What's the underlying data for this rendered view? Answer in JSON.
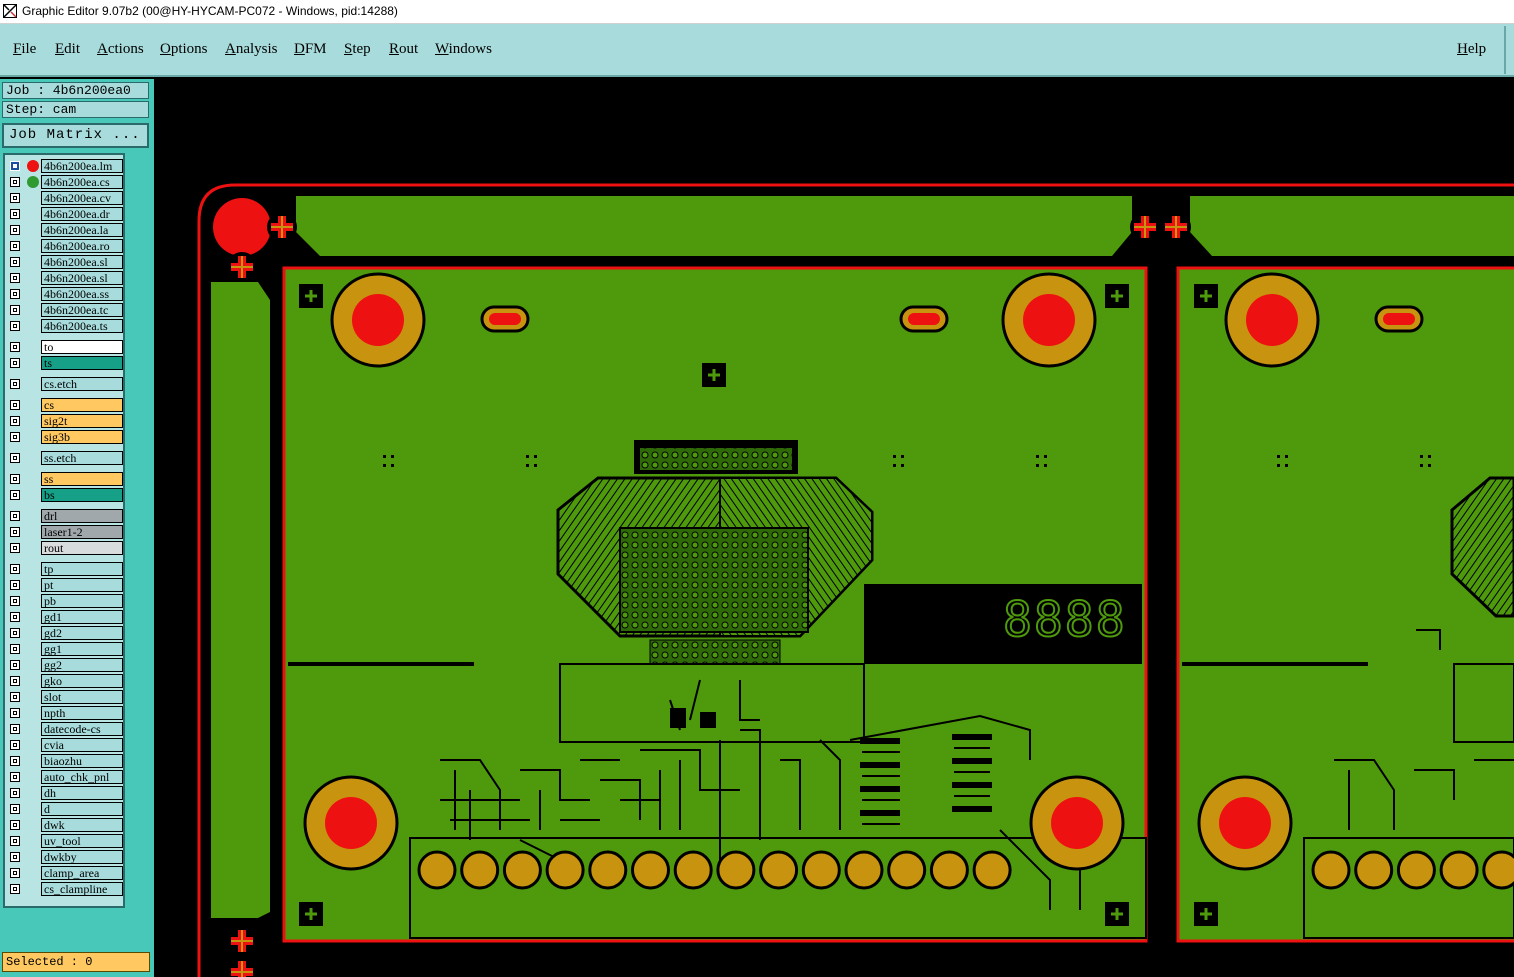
{
  "window": {
    "title": "Graphic Editor 9.07b2 (00@HY-HYCAM-PC072 - Windows, pid:14288)"
  },
  "menu": {
    "items": [
      "File",
      "Edit",
      "Actions",
      "Options",
      "Analysis",
      "DFM",
      "Step",
      "Rout",
      "Windows"
    ],
    "help": "Help"
  },
  "info": {
    "job": "Job : 4b6n200ea0",
    "step": "Step: cam"
  },
  "job_matrix_label": "Job Matrix ...",
  "layer_colors": {
    "lightcyan": "#a8dcdc",
    "white": "#ffffff",
    "teal": "#16a088",
    "orange": "#ffc860",
    "grey": "#a0a8ac",
    "lightgrey": "#d8dcdc"
  },
  "layers": [
    {
      "name": "4b6n200ea.lm",
      "bg": "lightcyan",
      "marker": "#ee1111",
      "selected": true
    },
    {
      "name": "4b6n200ea.cs",
      "bg": "lightcyan",
      "marker": "#2f9a2f"
    },
    {
      "name": "4b6n200ea.cv",
      "bg": "lightcyan"
    },
    {
      "name": "4b6n200ea.dr",
      "bg": "lightcyan"
    },
    {
      "name": "4b6n200ea.la",
      "bg": "lightcyan"
    },
    {
      "name": "4b6n200ea.ro",
      "bg": "lightcyan"
    },
    {
      "name": "4b6n200ea.sl",
      "bg": "lightcyan"
    },
    {
      "name": "4b6n200ea.sl",
      "bg": "lightcyan"
    },
    {
      "name": "4b6n200ea.ss",
      "bg": "lightcyan"
    },
    {
      "name": "4b6n200ea.tc",
      "bg": "lightcyan"
    },
    {
      "name": "4b6n200ea.ts",
      "bg": "lightcyan"
    },
    {
      "name": "to",
      "bg": "white",
      "gap": true
    },
    {
      "name": "ts",
      "bg": "teal"
    },
    {
      "name": "cs.etch",
      "bg": "lightcyan",
      "gap": true
    },
    {
      "name": "cs",
      "bg": "orange",
      "gap": true
    },
    {
      "name": "sig2t",
      "bg": "orange"
    },
    {
      "name": "sig3b",
      "bg": "orange"
    },
    {
      "name": "ss.etch",
      "bg": "lightcyan",
      "gap": true
    },
    {
      "name": "ss",
      "bg": "orange",
      "gap": true
    },
    {
      "name": "bs",
      "bg": "teal"
    },
    {
      "name": "drl",
      "bg": "grey",
      "gap": true
    },
    {
      "name": "laser1-2",
      "bg": "grey"
    },
    {
      "name": "rout",
      "bg": "lightgrey"
    },
    {
      "name": "tp",
      "bg": "lightcyan",
      "gap": true
    },
    {
      "name": "pt",
      "bg": "lightcyan"
    },
    {
      "name": "pb",
      "bg": "lightcyan"
    },
    {
      "name": "gd1",
      "bg": "lightcyan"
    },
    {
      "name": "gd2",
      "bg": "lightcyan"
    },
    {
      "name": "gg1",
      "bg": "lightcyan"
    },
    {
      "name": "gg2",
      "bg": "lightcyan"
    },
    {
      "name": "gko",
      "bg": "lightcyan"
    },
    {
      "name": "slot",
      "bg": "lightcyan"
    },
    {
      "name": "npth",
      "bg": "lightcyan"
    },
    {
      "name": "datecode-cs",
      "bg": "lightcyan"
    },
    {
      "name": "cvia",
      "bg": "lightcyan"
    },
    {
      "name": "biaozhu",
      "bg": "lightcyan"
    },
    {
      "name": "auto_chk_pnl",
      "bg": "lightcyan"
    },
    {
      "name": "dh",
      "bg": "lightcyan"
    },
    {
      "name": "d",
      "bg": "lightcyan"
    },
    {
      "name": "dwk",
      "bg": "lightcyan"
    },
    {
      "name": "uv_tool",
      "bg": "lightcyan"
    },
    {
      "name": "dwkby",
      "bg": "lightcyan"
    },
    {
      "name": "clamp_area",
      "bg": "lightcyan"
    },
    {
      "name": "cs_clampline",
      "bg": "lightcyan"
    }
  ],
  "status": {
    "selected": "Selected : 0"
  },
  "board": {
    "datecode": "8888"
  },
  "colors": {
    "copper": "#4e9a0c",
    "outline": "#ee1111",
    "pad": "#c89410",
    "drill": "#ee1111",
    "trace": "#000000",
    "background": "#000000"
  }
}
